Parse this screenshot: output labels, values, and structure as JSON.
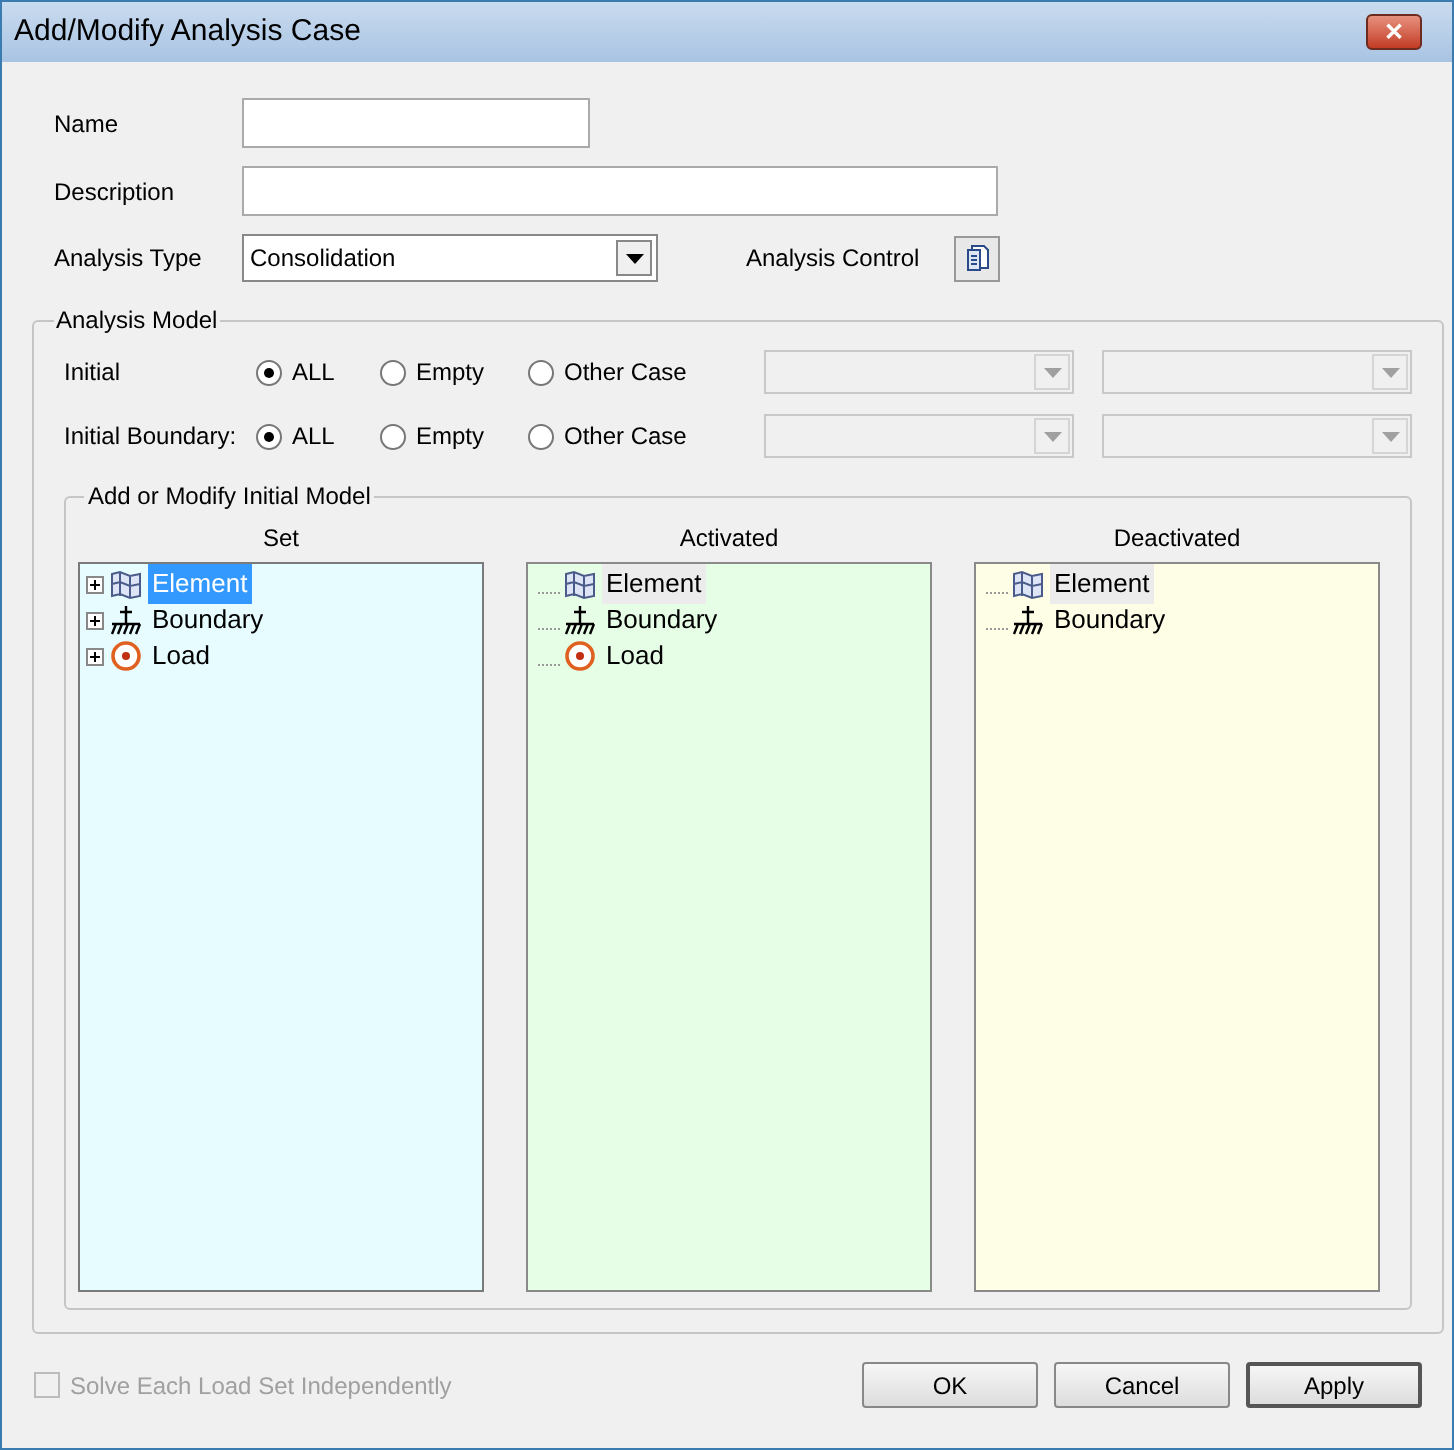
{
  "window": {
    "title": "Add/Modify Analysis Case",
    "close": "✕"
  },
  "fields": [
    {
      "label": "Name"
    },
    {
      "label": "Description"
    }
  ],
  "analysis_type": {
    "label": "Analysis Type",
    "value": "Consolidation"
  },
  "analysis_control": {
    "label": "Analysis Control"
  },
  "analysis_model": {
    "title": "Analysis Model",
    "rows": [
      {
        "label": "Initial",
        "options": [
          {
            "label": "ALL",
            "selected": true
          },
          {
            "label": "Empty",
            "selected": false
          },
          {
            "label": "Other Case",
            "selected": false
          }
        ],
        "dropdowns_disabled": true
      },
      {
        "label": "Initial Boundary:",
        "options": [
          {
            "label": "ALL",
            "selected": true
          },
          {
            "label": "Empty",
            "selected": false
          },
          {
            "label": "Other Case",
            "selected": false
          }
        ],
        "dropdowns_disabled": true
      }
    ]
  },
  "initial_model": {
    "title": "Add or Modify Initial Model",
    "panels": [
      {
        "heading": "Set",
        "color": "#e6fcff",
        "focused": true,
        "items": [
          {
            "label": "Element",
            "kind": "element",
            "expandable": true,
            "selected": true
          },
          {
            "label": "Boundary",
            "kind": "boundary",
            "expandable": true,
            "selected": false
          },
          {
            "label": "Load",
            "kind": "load",
            "expandable": true,
            "selected": false
          }
        ]
      },
      {
        "heading": "Activated",
        "color": "#e6fde6",
        "focused": false,
        "items": [
          {
            "label": "Element",
            "kind": "element",
            "expandable": false,
            "selected": true
          },
          {
            "label": "Boundary",
            "kind": "boundary",
            "expandable": false,
            "selected": false
          },
          {
            "label": "Load",
            "kind": "load",
            "expandable": false,
            "selected": false
          }
        ]
      },
      {
        "heading": "Deactivated",
        "color": "#fefde6",
        "focused": false,
        "items": [
          {
            "label": "Element",
            "kind": "element",
            "expandable": false,
            "selected": true
          },
          {
            "label": "Boundary",
            "kind": "boundary",
            "expandable": false,
            "selected": false
          }
        ]
      }
    ]
  },
  "solve_independently": {
    "label": "Solve Each Load Set Independently",
    "checked": false,
    "disabled": true
  },
  "buttons": [
    {
      "label": "OK",
      "default": false
    },
    {
      "label": "Cancel",
      "default": false
    },
    {
      "label": "Apply",
      "default": true
    }
  ]
}
